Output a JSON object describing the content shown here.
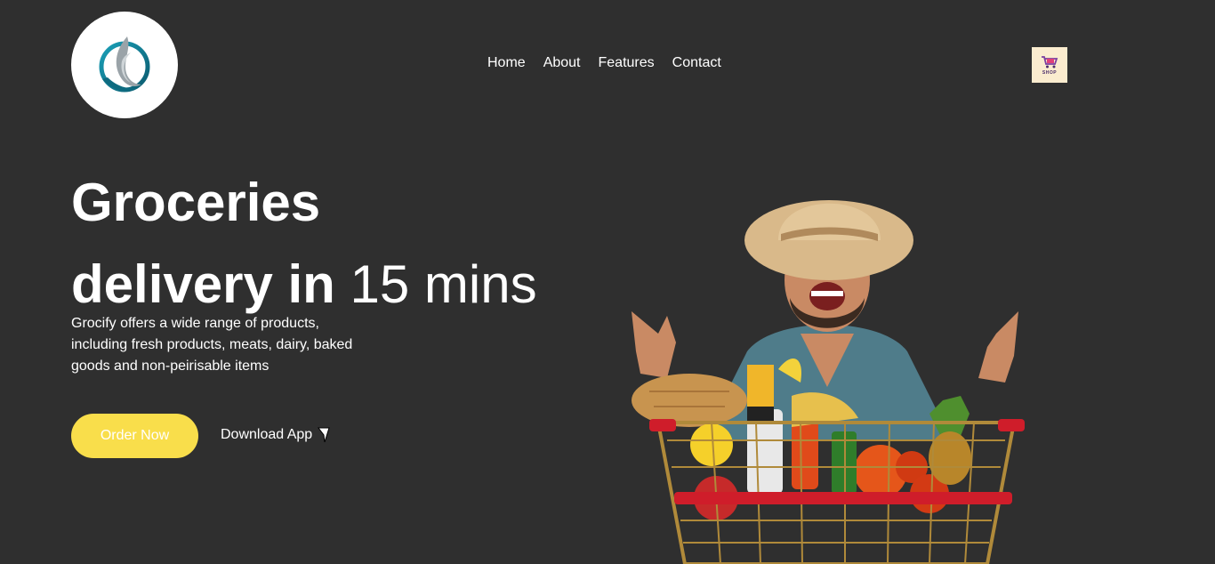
{
  "nav": {
    "items": [
      "Home",
      "About",
      "Features",
      "Contact"
    ]
  },
  "cart": {
    "label": "SHOP",
    "icon": "shopping-cart-icon"
  },
  "hero": {
    "title_line1": "Groceries",
    "title_line2_bold": "delivery in",
    "title_line2_light": "15 mins",
    "description": "Grocify offers a wide range of products, including fresh products, meats, dairy, baked goods and non-peirisable items",
    "order_label": "Order Now",
    "download_label": "Download App",
    "download_icon": "cursor-arrow-icon"
  },
  "colors": {
    "background": "#2f2f2f",
    "accent": "#f9de4b",
    "text": "#ffffff"
  }
}
